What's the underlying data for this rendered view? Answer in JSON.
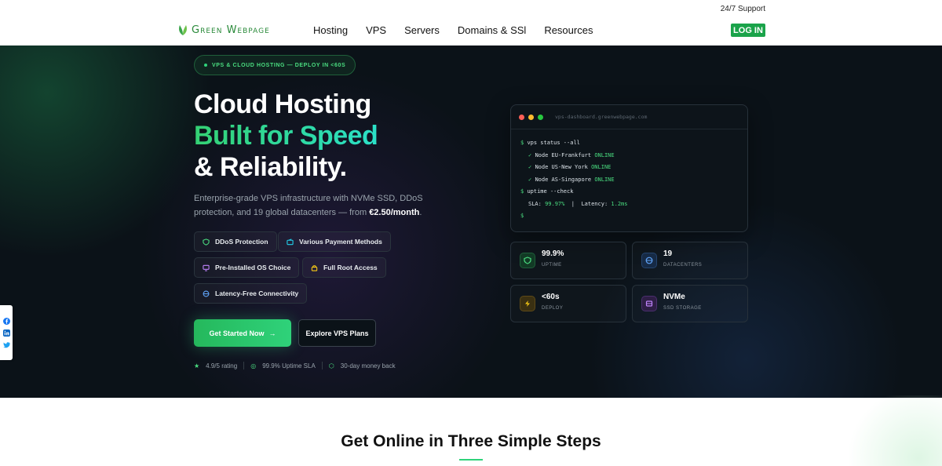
{
  "topbar": {
    "support": "24/7 Support",
    "logo_text": "Green Webpage",
    "nav": [
      "Hosting",
      "VPS",
      "Servers",
      "Domains & SSl",
      "Resources"
    ],
    "login": "LOG IN"
  },
  "hero": {
    "badge": "VPS & CLOUD HOSTING — DEPLOY IN <60S",
    "title_line1": "Cloud Hosting",
    "title_line2": "Built for Speed",
    "title_line3": "& Reliability.",
    "lead_text": "Enterprise-grade VPS infrastructure with NVMe SSD, DDoS protection, and 19 global datacenters — from ",
    "lead_price": "€2.50/month",
    "lead_end": ".",
    "features": [
      "DDoS Protection",
      "Various Payment Methods",
      "Pre-Installed OS Choice",
      "Full Root Access",
      "Latency-Free Connectivity"
    ],
    "cta_primary": "Get Started Now",
    "cta_arrow": "→",
    "cta_secondary": "Explore VPS Plans",
    "trust": [
      "4.9/5 rating",
      "99.9% Uptime SLA",
      "30-day money back"
    ]
  },
  "terminal": {
    "url": "vps-dashboard.greenwebpage.com",
    "cmd1": "vps status --all",
    "nodes": [
      {
        "name": "Node EU-Frankfurt",
        "status": "ONLINE"
      },
      {
        "name": "Node US-New York",
        "status": "ONLINE"
      },
      {
        "name": "Node AS-Singapore",
        "status": "ONLINE"
      }
    ],
    "cmd2": "uptime --check",
    "sla_label": "SLA:",
    "sla_value": "99.97%",
    "latency_label": "Latency:",
    "latency_value": "1.2ms",
    "prompt": "$"
  },
  "stats": [
    {
      "value": "99.9%",
      "label": "UPTIME"
    },
    {
      "value": "19",
      "label": "DATACENTERS"
    },
    {
      "value": "<60s",
      "label": "DEPLOY"
    },
    {
      "value": "NVMe",
      "label": "SSD STORAGE"
    }
  ],
  "section": {
    "title": "Get Online in Three Simple Steps"
  },
  "colors": {
    "accent": "#2fd27a",
    "dark_bg": "#0b1218",
    "login_bg": "#1aa34a"
  }
}
